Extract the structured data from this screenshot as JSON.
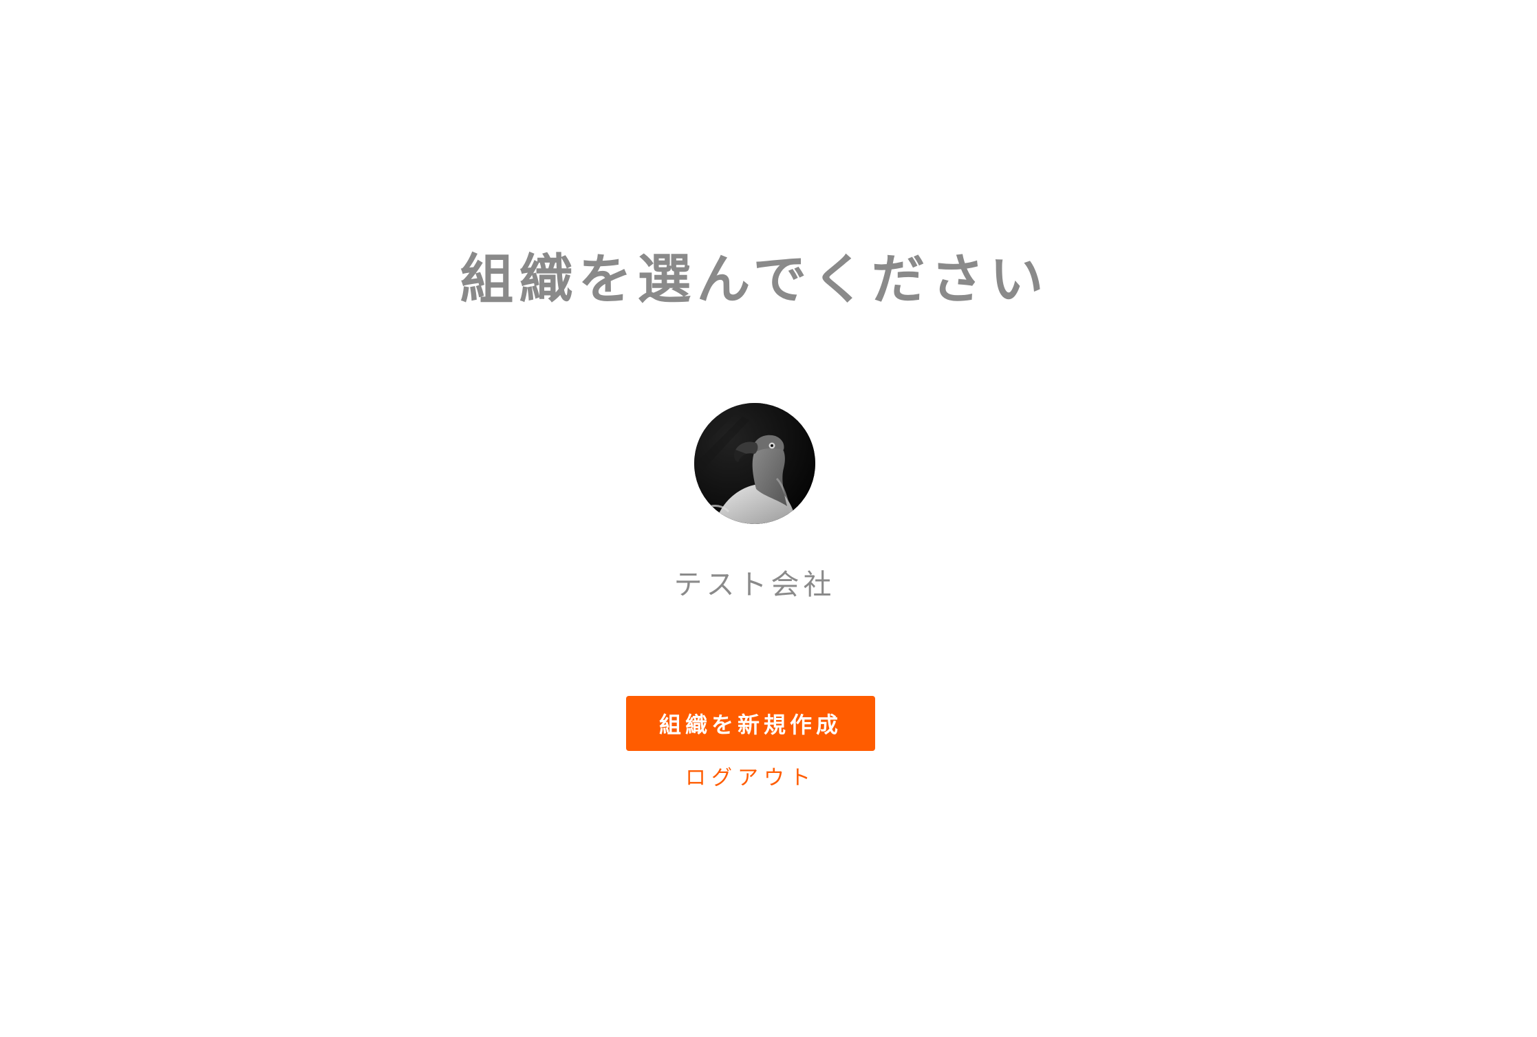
{
  "page": {
    "title": "組織を選んでください"
  },
  "organizations": [
    {
      "name": "テスト会社",
      "avatar_icon": "vulture-photo-avatar"
    }
  ],
  "actions": {
    "create_label": "組織を新規作成",
    "logout_label": "ログアウト"
  },
  "colors": {
    "accent": "#ff5c00",
    "text_gray": "#8a8a8a",
    "background": "#ffffff"
  }
}
